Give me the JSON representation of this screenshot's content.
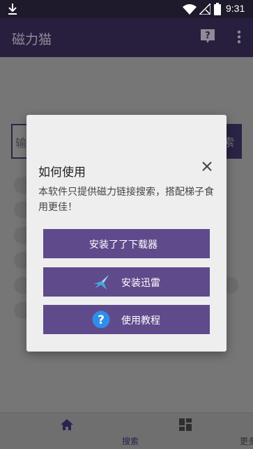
{
  "status_bar": {
    "time": "9:31"
  },
  "app_bar": {
    "title": "磁力猫"
  },
  "search": {
    "input_partial": "输",
    "button_partial": "索"
  },
  "nav": {
    "search_label": "搜索",
    "more_label": "更多"
  },
  "dialog": {
    "title": "如何使用",
    "message": "本软件只提供磁力链接搜索，搭配梯子食用更佳！",
    "buttons": {
      "install_downloader": "安装了了下载器",
      "install_xunlei": "安装迅雷",
      "tutorial": "使用教程"
    }
  },
  "colors": {
    "accent": "#5f4a8c",
    "app_bar": "#271f3d",
    "dialog_bg": "#eeeeee"
  }
}
